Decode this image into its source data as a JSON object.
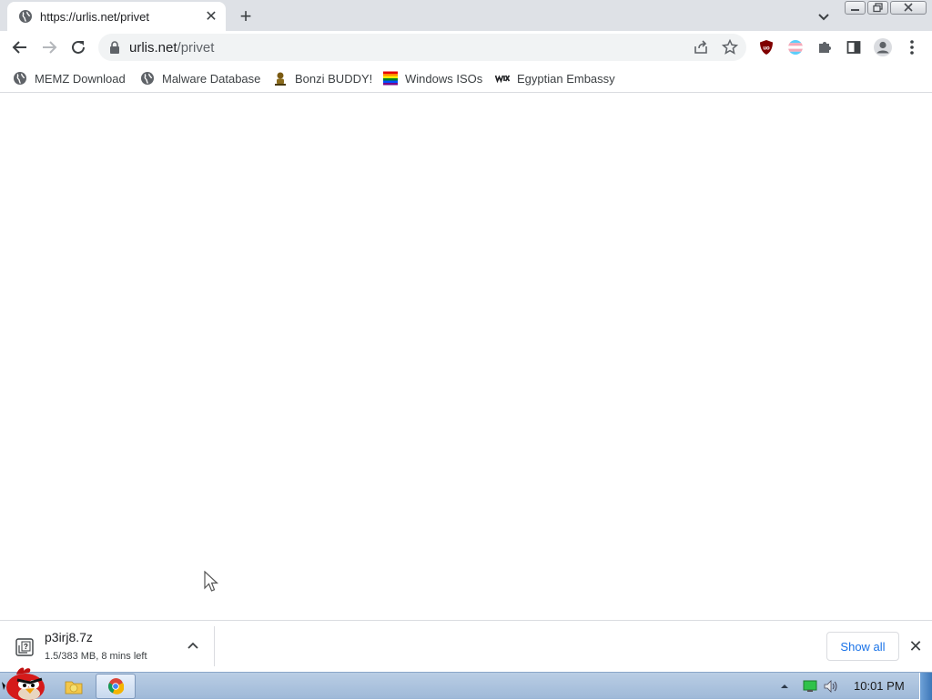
{
  "tab": {
    "title": "https://urlis.net/privet",
    "close_symbol": "✕",
    "new_tab_symbol": "+"
  },
  "omnibox": {
    "host": "urlis.net",
    "path": "/privet"
  },
  "bookmarks": [
    {
      "label": "MEMZ Download",
      "icon": "globe-icon"
    },
    {
      "label": "Malware Database",
      "icon": "globe-icon"
    },
    {
      "label": "Bonzi BUDDY!",
      "icon": "bonzi-icon"
    },
    {
      "label": "Windows ISOs",
      "icon": "rainbow-flag-icon"
    },
    {
      "label": "Egyptian Embassy",
      "icon": "wix-icon"
    }
  ],
  "download": {
    "filename": "p3irj8.7z",
    "status": "1.5/383 MB, 8 mins left",
    "show_all_label": "Show all",
    "close_symbol": "✕"
  },
  "taskbar": {
    "clock": "10:01 PM"
  },
  "colors": {
    "tabstrip_bg": "#dee1e6",
    "accent_blue": "#1a73e8",
    "taskbar_bg": "#b9cde4"
  }
}
